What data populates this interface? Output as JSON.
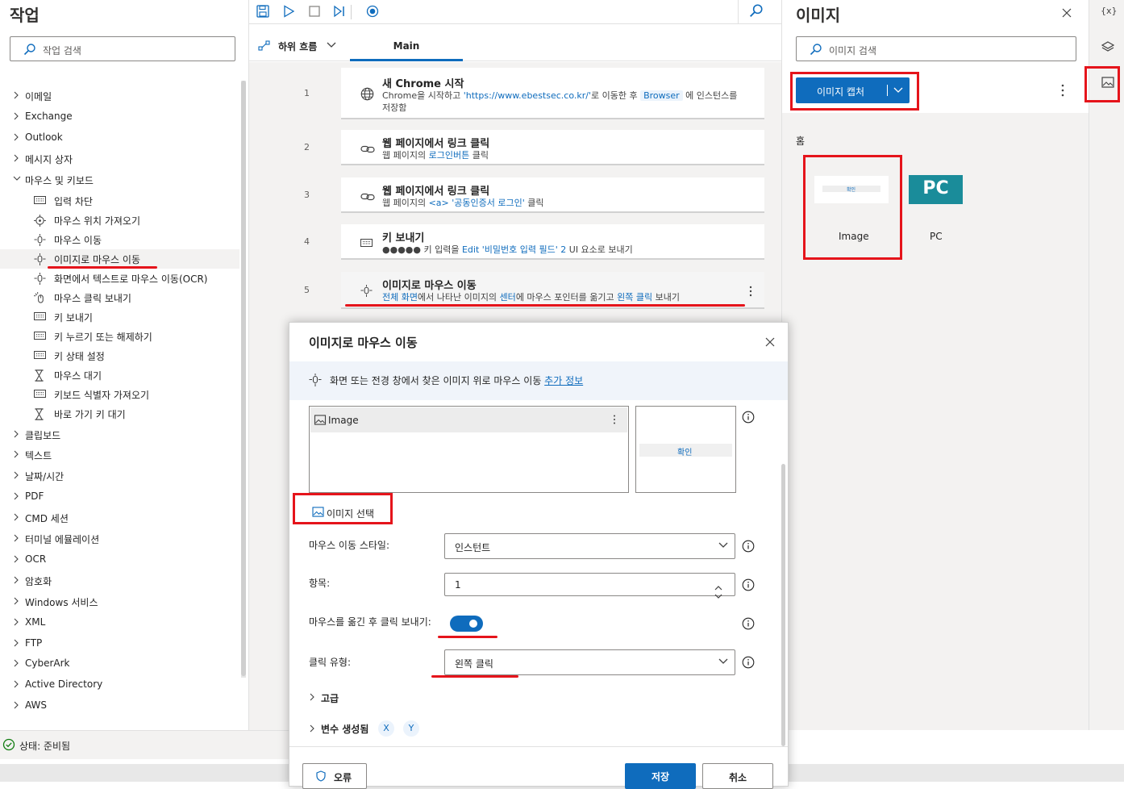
{
  "left": {
    "title": "작업",
    "search_placeholder": "작업 검색",
    "tree": [
      {
        "label": "이메일",
        "expanded": false
      },
      {
        "label": "Exchange",
        "expanded": false
      },
      {
        "label": "Outlook",
        "expanded": false
      },
      {
        "label": "메시지 상자",
        "expanded": false
      },
      {
        "label": "마우스 및 키보드",
        "expanded": true
      },
      {
        "label": "클립보드",
        "expanded": false
      },
      {
        "label": "텍스트",
        "expanded": false
      },
      {
        "label": "날짜/시간",
        "expanded": false
      },
      {
        "label": "PDF",
        "expanded": false
      },
      {
        "label": "CMD 세션",
        "expanded": false
      },
      {
        "label": "터미널 에뮬레이션",
        "expanded": false
      },
      {
        "label": "OCR",
        "expanded": false
      },
      {
        "label": "암호화",
        "expanded": false
      },
      {
        "label": "Windows 서비스",
        "expanded": false
      },
      {
        "label": "XML",
        "expanded": false
      },
      {
        "label": "FTP",
        "expanded": false
      },
      {
        "label": "CyberArk",
        "expanded": false
      },
      {
        "label": "Active Directory",
        "expanded": false
      },
      {
        "label": "AWS",
        "expanded": false
      }
    ],
    "subitems": [
      {
        "label": "입력 차단",
        "icon": "keyboard-icon"
      },
      {
        "label": "마우스 위치 가져오기",
        "icon": "crosshair-icon"
      },
      {
        "label": "마우스 이동",
        "icon": "mouse-move-icon"
      },
      {
        "label": "이미지로 마우스 이동",
        "icon": "mouse-move-icon",
        "selected": true
      },
      {
        "label": "화면에서 텍스트로 마우스 이동(OCR)",
        "icon": "mouse-move-icon"
      },
      {
        "label": "마우스 클릭 보내기",
        "icon": "mouse-click-icon"
      },
      {
        "label": "키 보내기",
        "icon": "keyboard-icon"
      },
      {
        "label": "키 누르기 또는 해제하기",
        "icon": "keyboard-icon"
      },
      {
        "label": "키 상태 설정",
        "icon": "keyboard-icon"
      },
      {
        "label": "마우스 대기",
        "icon": "hourglass-icon"
      },
      {
        "label": "키보드 식별자 가져오기",
        "icon": "keyboard-icon"
      },
      {
        "label": "바로 가기 키 대기",
        "icon": "hourglass-icon"
      }
    ]
  },
  "status": {
    "label": "상태: 준비됨"
  },
  "flow": {
    "subflow_label": "하위 흐름",
    "main_tab": "Main",
    "steps": [
      {
        "num": "1",
        "title": "새 Chrome 시작",
        "d1": "Chrome을 시작하고 ",
        "d2": "'https://www.ebestsec.co.kr/'",
        "d3": "로 이동한 후 ",
        "d4": "Browser",
        "d5": " 에 인스턴스를 저장함"
      },
      {
        "num": "2",
        "title": "웹 페이지에서 링크 클릭",
        "d1": "웹 페이지의 ",
        "d2": "로그인버튼",
        "d3": " 클릭"
      },
      {
        "num": "3",
        "title": "웹 페이지에서 링크 클릭",
        "d1": "웹 페이지의 ",
        "d2": "<a> '공동인증서 로그인'",
        "d3": " 클릭"
      },
      {
        "num": "4",
        "title": "키 보내기",
        "d1": "●●●●● 키 입력을 ",
        "d2": "Edit '비밀번호 입력 필드' 2",
        "d3": " UI 요소로 보내기"
      },
      {
        "num": "5",
        "title": "이미지로 마우스 이동",
        "d1": "전체 화면",
        "d2": "에서 나타난 이미지의 ",
        "d3": "센터",
        "d4": "에 마우스 포인터를 옮기고 ",
        "d5": "왼쪽 클릭",
        "d6": " 보내기"
      }
    ]
  },
  "images": {
    "title": "이미지",
    "search_placeholder": "이미지 검색",
    "capture_label": "이미지 캡처",
    "section_label": "홈",
    "items": [
      {
        "label": "Image",
        "thumb_text": "확인"
      },
      {
        "label": "PC",
        "thumb_text": "PC"
      }
    ]
  },
  "rightbar": {
    "variables_label": "{x}"
  },
  "dialog": {
    "title": "이미지로 마우스 이동",
    "info_text": "화면 또는 전경 창에서 찾은 이미지 위로 마우스 이동 ",
    "info_link": "추가 정보",
    "image_item": "Image",
    "preview_text": "확인",
    "select_image": "이미지 선택",
    "move_style_label": "마우스 이동 스타일:",
    "move_style_value": "인스턴트",
    "occurrence_label": "항목:",
    "occurrence_value": "1",
    "send_click_label": "마우스를 옮긴 후 클릭 보내기:",
    "send_click_on": true,
    "click_type_label": "클릭 유형:",
    "click_type_value": "왼쪽 클릭",
    "advanced_label": "고급",
    "vars_label": "변수 생성됨",
    "var_x": "X",
    "var_y": "Y",
    "error_btn": "오류",
    "save_btn": "저장",
    "cancel_btn": "취소"
  },
  "colors": {
    "accent": "#0f6cbd",
    "highlight": "#e5141b"
  }
}
